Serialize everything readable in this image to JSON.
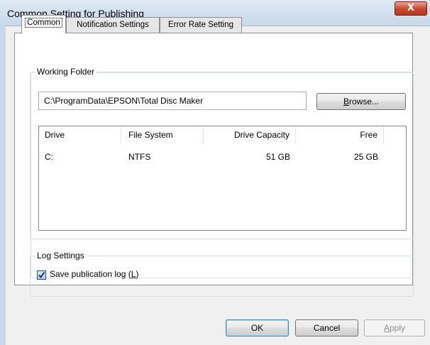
{
  "window": {
    "title": "Common Setting for Publishing",
    "close_glyph": "X"
  },
  "tabs": [
    {
      "label": "Common",
      "active": true
    },
    {
      "label": "Notification Settings",
      "active": false
    },
    {
      "label": "Error Rate Setting",
      "active": false
    }
  ],
  "working_folder": {
    "group_label": "Working Folder",
    "path": "C:\\ProgramData\\EPSON\\Total Disc Maker",
    "browse_mnemonic": "B",
    "browse_rest": "rowse..."
  },
  "drives": {
    "columns": [
      "Drive",
      "File System",
      "Drive Capacity",
      "Free"
    ],
    "rows": [
      {
        "drive": "C:",
        "file_system": "NTFS",
        "capacity": "51 GB",
        "free": "25 GB"
      }
    ]
  },
  "log_settings": {
    "group_label": "Log Settings",
    "save_log_label": "Save publication log (",
    "save_log_mnemonic": "L",
    "save_log_suffix": ")",
    "checked": true
  },
  "buttons": {
    "ok": "OK",
    "cancel": "Cancel",
    "apply_mnemonic": "A",
    "apply_rest": "pply"
  },
  "colors": {
    "accent_border": "#3c7fb1",
    "close_red": "#c7452d"
  }
}
